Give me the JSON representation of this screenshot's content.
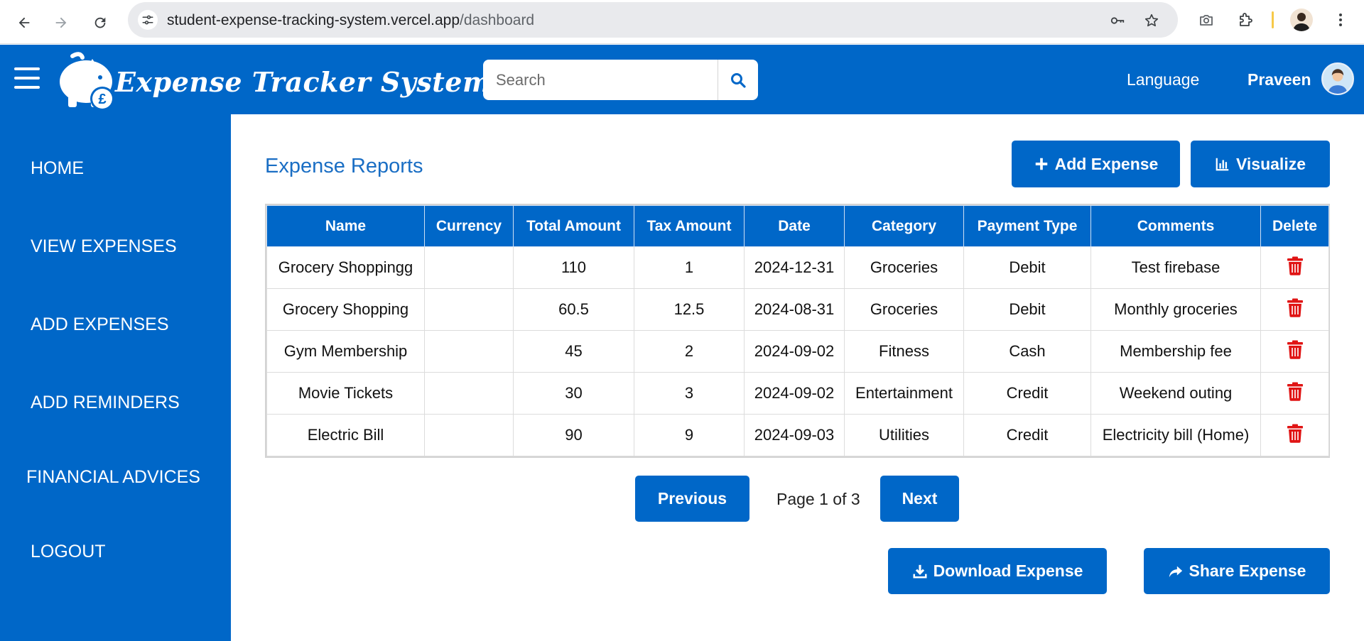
{
  "browser": {
    "url_domain": "student-expense-tracking-system.vercel.app",
    "url_path": "/dashboard"
  },
  "header": {
    "brand": "Expense Tracker System",
    "search_placeholder": "Search",
    "language": "Language",
    "username": "Praveen"
  },
  "sidebar": {
    "items": [
      {
        "label": "HOME"
      },
      {
        "label": "VIEW EXPENSES"
      },
      {
        "label": "ADD EXPENSES"
      },
      {
        "label": "ADD REMINDERS"
      },
      {
        "label": "FINANCIAL ADVICES"
      },
      {
        "label": "LOGOUT"
      }
    ]
  },
  "main": {
    "title": "Expense Reports",
    "add_expense": "Add Expense",
    "visualize": "Visualize",
    "table": {
      "columns": [
        "Name",
        "Currency",
        "Total Amount",
        "Tax Amount",
        "Date",
        "Category",
        "Payment Type",
        "Comments",
        "Delete"
      ],
      "rows": [
        {
          "name": "Grocery Shoppingg",
          "currency": "",
          "total": "110",
          "tax": "1",
          "date": "2024-12-31",
          "category": "Groceries",
          "payment": "Debit",
          "comments": "Test firebase"
        },
        {
          "name": "Grocery Shopping",
          "currency": "",
          "total": "60.5",
          "tax": "12.5",
          "date": "2024-08-31",
          "category": "Groceries",
          "payment": "Debit",
          "comments": "Monthly groceries"
        },
        {
          "name": "Gym Membership",
          "currency": "",
          "total": "45",
          "tax": "2",
          "date": "2024-09-02",
          "category": "Fitness",
          "payment": "Cash",
          "comments": "Membership fee"
        },
        {
          "name": "Movie Tickets",
          "currency": "",
          "total": "30",
          "tax": "3",
          "date": "2024-09-02",
          "category": "Entertainment",
          "payment": "Credit",
          "comments": "Weekend outing"
        },
        {
          "name": "Electric Bill",
          "currency": "",
          "total": "90",
          "tax": "9",
          "date": "2024-09-03",
          "category": "Utilities",
          "payment": "Credit",
          "comments": "Electricity bill (Home)"
        }
      ]
    },
    "pagination": {
      "previous": "Previous",
      "info": "Page 1 of 3",
      "next": "Next"
    },
    "download": "Download Expense",
    "share": "Share Expense"
  },
  "colors": {
    "primary": "#0067c8",
    "delete": "#e01414"
  },
  "icons": {
    "back": "arrow-left-icon",
    "forward": "arrow-right-icon",
    "reload": "reload-icon",
    "site_settings": "tune-icon",
    "password": "key-icon",
    "bookmark": "star-icon",
    "screenshot": "camera-icon",
    "extensions": "puzzle-icon",
    "menu": "kebab-icon",
    "search": "search-icon",
    "add": "plus-icon",
    "chart": "bar-chart-icon",
    "delete": "trash-icon",
    "download": "download-icon",
    "share": "share-icon"
  }
}
